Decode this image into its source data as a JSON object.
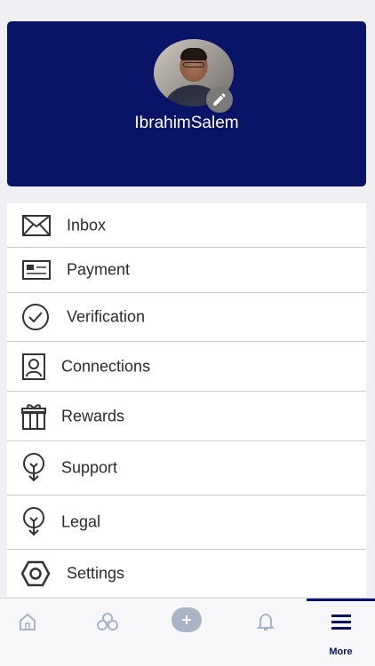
{
  "profile": {
    "name": "IbrahimSalem"
  },
  "menu": {
    "items": [
      {
        "label": "Inbox",
        "icon": "envelope-icon"
      },
      {
        "label": "Payment",
        "icon": "id-card-icon"
      },
      {
        "label": "Verification",
        "icon": "check-circle-icon"
      },
      {
        "label": "Connections",
        "icon": "contact-badge-icon"
      },
      {
        "label": "Rewards",
        "icon": "gift-icon"
      },
      {
        "label": "Support",
        "icon": "lightbulb-icon"
      },
      {
        "label": "Legal",
        "icon": "lightbulb-icon"
      },
      {
        "label": "Settings",
        "icon": "hexagon-gear-icon"
      }
    ]
  },
  "tabbar": {
    "tabs": [
      {
        "icon": "home-icon",
        "label": ""
      },
      {
        "icon": "circles-icon",
        "label": ""
      },
      {
        "icon": "plus-icon",
        "label": ""
      },
      {
        "icon": "bell-icon",
        "label": ""
      },
      {
        "icon": "menu-icon",
        "label": "More",
        "active": true
      }
    ]
  },
  "colors": {
    "brand": "#0a1466",
    "inactive_tab": "#a8b3c4",
    "text": "#2b2b2b"
  }
}
